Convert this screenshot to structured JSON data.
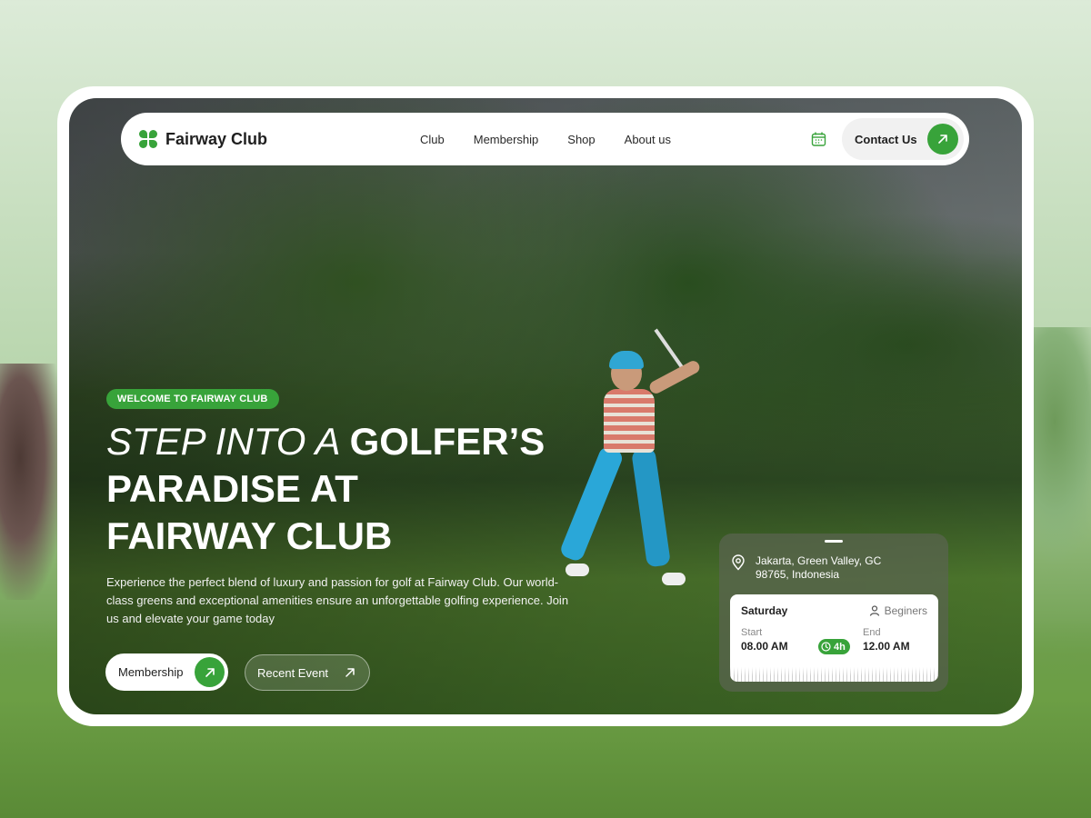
{
  "brand": {
    "name": "Fairway Club",
    "accent": "#38a33a"
  },
  "nav": {
    "links": [
      "Club",
      "Membership",
      "Shop",
      "About us"
    ],
    "calendar_icon": "calendar-icon",
    "contact_label": "Contact Us"
  },
  "hero": {
    "badge": "WELCOME TO FAIRWAY CLUB",
    "headline_light": "STEP INTO A ",
    "headline_bold_1": "GOLFER’S",
    "headline_bold_2": "PARADISE AT",
    "headline_bold_3": "FAIRWAY CLUB",
    "description": "Experience the perfect blend of luxury and passion for golf at Fairway Club. Our world-class greens and exceptional amenities ensure an unforgettable golfing experience. Join us and elevate your game today",
    "primary_button": "Membership",
    "secondary_button": "Recent Event"
  },
  "info_card": {
    "address_line1": "Jakarta, Green Valley, GC",
    "address_line2": "98765, Indonesia",
    "day": "Saturday",
    "level": "Beginers",
    "start_label": "Start",
    "start_time": "08.00 AM",
    "duration": "4h",
    "end_label": "End",
    "end_time": "12.00 AM"
  }
}
